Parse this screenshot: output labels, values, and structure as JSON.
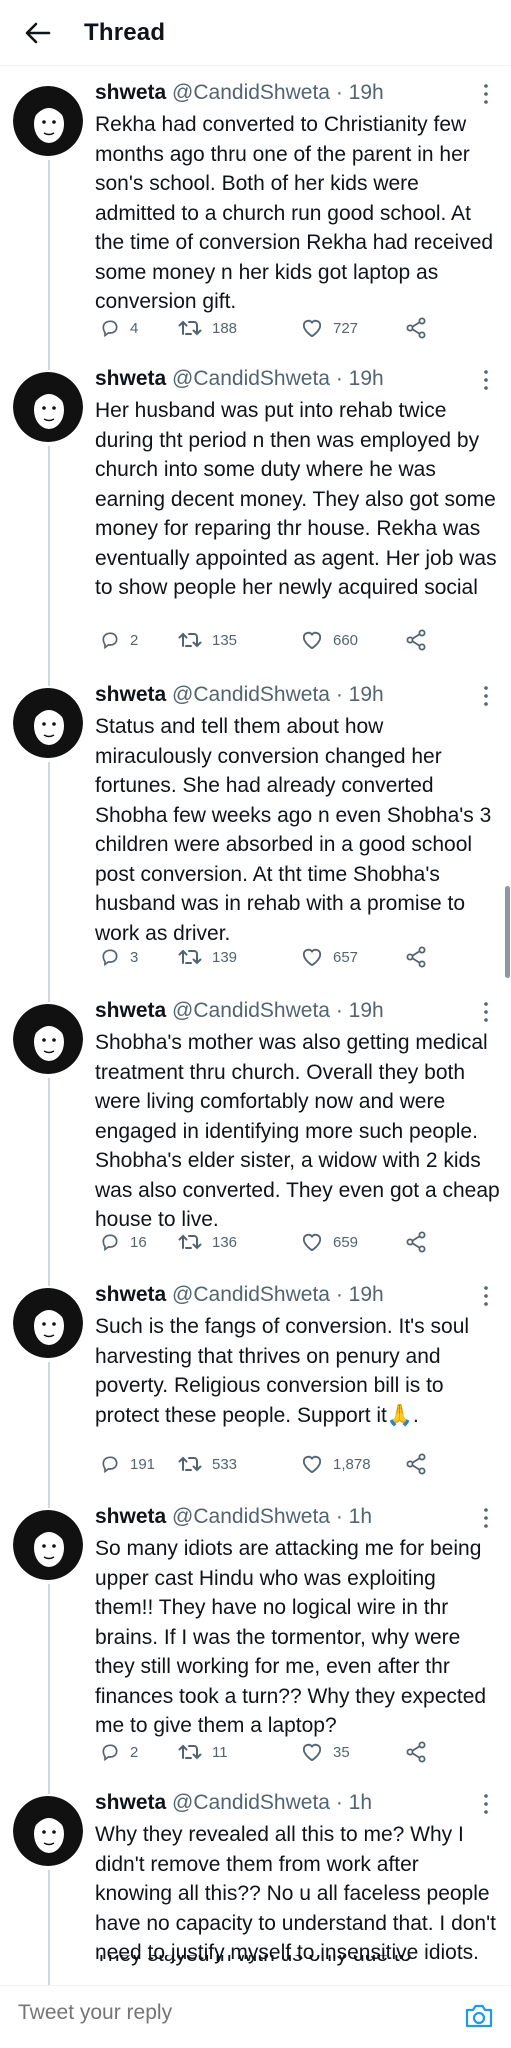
{
  "header": {
    "title": "Thread"
  },
  "colors": {
    "text": "#0f1419",
    "muted": "#536471",
    "accent": "#1d9bf0",
    "line": "#cfd9de"
  },
  "tweets": [
    {
      "name": "shweta",
      "handle": "@CandidShweta",
      "time": "· 19h",
      "text": "Rekha had converted to Christianity few months ago thru one of the parent in her son's school. Both of her kids were admitted to a church run good school. At the time of conversion Rekha had received some money n her kids got laptop as conversion gift.",
      "replies": "4",
      "retweets": "188",
      "likes": "727"
    },
    {
      "name": "shweta",
      "handle": "@CandidShweta",
      "time": "· 19h",
      "text": "Her husband was put into rehab twice during tht period n then was employed by church into some duty where he was earning decent money. They also got some money for reparing thr house. Rekha was eventually appointed as agent. Her job was to show people her newly acquired social",
      "replies": "2",
      "retweets": "135",
      "likes": "660"
    },
    {
      "name": "shweta",
      "handle": "@CandidShweta",
      "time": "· 19h",
      "text": "Status and tell them about how miraculously conversion changed her fortunes. She had already converted Shobha few weeks ago n even Shobha's 3 children were absorbed in a good school post conversion. At tht time Shobha's husband was in rehab with a promise to work as driver.",
      "replies": "3",
      "retweets": "139",
      "likes": "657"
    },
    {
      "name": "shweta",
      "handle": "@CandidShweta",
      "time": "· 19h",
      "text": "Shobha's mother was also getting medical treatment thru church. Overall they both were living comfortably now and were engaged in identifying more such people. Shobha's elder sister, a widow with 2 kids was also converted. They even got a cheap house to live.",
      "replies": "16",
      "retweets": "136",
      "likes": "659"
    },
    {
      "name": "shweta",
      "handle": "@CandidShweta",
      "time": "· 19h",
      "text": "Such is the fangs of conversion. It's soul harvesting that thrives on penury and poverty. Religious conversion bill is to protect these people. Support it🙏.",
      "replies": "191",
      "retweets": "533",
      "likes": "1,878"
    },
    {
      "name": "shweta",
      "handle": "@CandidShweta",
      "time": "· 1h",
      "text": "So many idiots are attacking me for being upper cast Hindu who was exploiting them!! They have no logical wire in thr brains. If I was the tormentor, why were they still working for me, even after thr finances took a turn?? Why they expected me to give them a laptop?",
      "replies": "2",
      "retweets": "11",
      "likes": "35"
    },
    {
      "name": "shweta",
      "handle": "@CandidShweta",
      "time": "· 1h",
      "text": "Why they revealed all this to me? Why I didn't remove them from work after knowing all this?? No u all faceless people have no capacity to understand that. I don't need to justify myself to insensitive idiots.",
      "replies": "",
      "retweets": "",
      "likes": ""
    }
  ],
  "partial_text": "They stayed in with us only due to",
  "reply": {
    "placeholder": "Tweet your reply"
  }
}
